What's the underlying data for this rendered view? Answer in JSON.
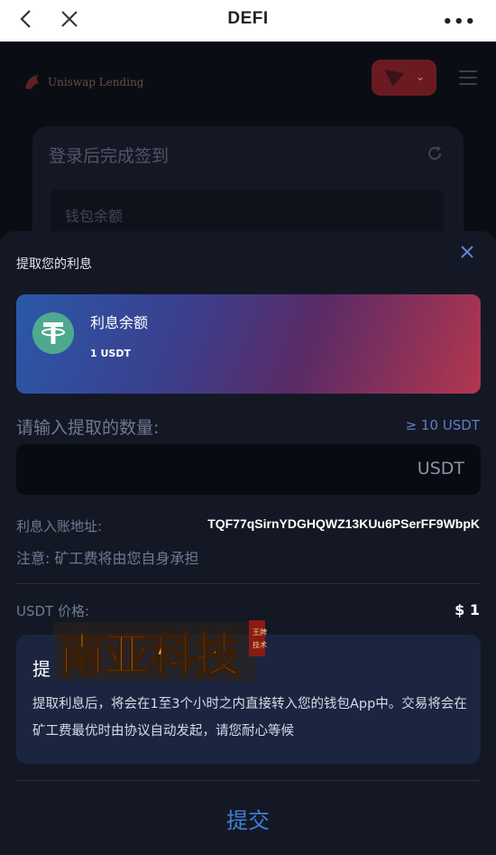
{
  "topbar": {
    "title": "DEFI",
    "back_icon": "chevron-left-icon",
    "close_icon": "close-icon",
    "more_label": "•••"
  },
  "background": {
    "logo_text": "Uniswap Lending",
    "network_chevron": "⌄",
    "card_title": "登录后完成签到",
    "wallet_label": "钱包余额"
  },
  "sheet": {
    "title": "提取您的利息",
    "balance": {
      "label": "利息余额",
      "value": "1 USDT"
    },
    "amount": {
      "label": "请输入提取的数量:",
      "minimum": "≥ 10 USDT",
      "unit": "USDT",
      "value": ""
    },
    "address": {
      "label": "利息入账地址:",
      "value": "TQF77qSirnYDGHQWZ13KUu6PSerFF9WbpK"
    },
    "note": "注意: 矿工费将由您自身承担",
    "price": {
      "label": "USDT 价格:",
      "value": "$ 1"
    },
    "info": {
      "heading": "提",
      "text": "提取利息后，将会在1至3个小时之内直接转入您的钱包App中。交易将会在矿工费最优时由协议自动发起，请您耐心等候"
    },
    "submit_label": "提交"
  },
  "watermark": {
    "text": "南亚科技",
    "seal": "王牌 技术"
  },
  "colors": {
    "accent": "#3f7fd6",
    "sheet_bg": "#141824",
    "tether_green": "#4ea98f"
  }
}
